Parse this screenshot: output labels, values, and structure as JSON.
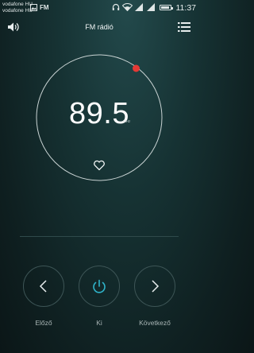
{
  "status_bar": {
    "carrier1": "vodafone HU",
    "carrier2": "vodafone HU",
    "fm_badge": "FM",
    "time": "11:37",
    "icons": [
      "image-icon",
      "headphones-icon",
      "wifi-icon",
      "signal-icon",
      "battery-icon"
    ]
  },
  "header": {
    "title": "FM rádió",
    "speaker_icon": "speaker-icon",
    "menu_icon": "list-menu-icon"
  },
  "tuner": {
    "frequency": "89.5",
    "unit": "MHz",
    "indicator_color": "#e53935",
    "ring_color": "#c9d3d3"
  },
  "controls": {
    "prev_label": "Előző",
    "power_label": "Ki",
    "next_label": "Következő",
    "power_color": "#2fb3c9"
  }
}
